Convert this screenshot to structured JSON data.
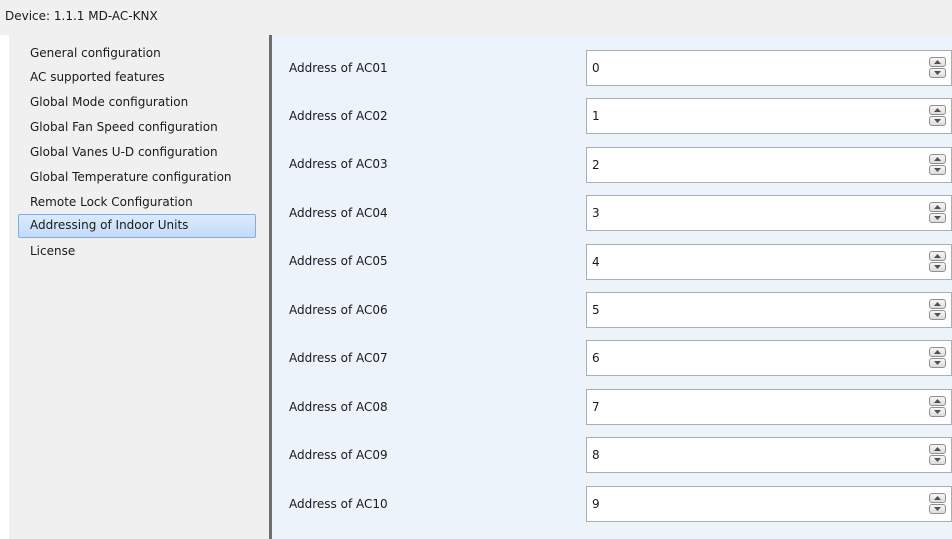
{
  "window": {
    "title": "Device: 1.1.1  MD-AC-KNX"
  },
  "sidebar": {
    "items": [
      {
        "label": "General configuration"
      },
      {
        "label": "AC supported features"
      },
      {
        "label": "Global Mode configuration"
      },
      {
        "label": "Global Fan Speed configuration"
      },
      {
        "label": "Global Vanes U-D configuration"
      },
      {
        "label": "Global Temperature configuration"
      },
      {
        "label": "Remote Lock Configuration"
      },
      {
        "label": "Addressing of Indoor Units",
        "selected": true
      },
      {
        "label": "License"
      }
    ]
  },
  "main": {
    "rows": [
      {
        "label": "Address of AC01",
        "value": "0"
      },
      {
        "label": "Address of AC02",
        "value": "1"
      },
      {
        "label": "Address of AC03",
        "value": "2"
      },
      {
        "label": "Address of AC04",
        "value": "3"
      },
      {
        "label": "Address of AC05",
        "value": "4"
      },
      {
        "label": "Address of AC06",
        "value": "5"
      },
      {
        "label": "Address of AC07",
        "value": "6"
      },
      {
        "label": "Address of AC08",
        "value": "7"
      },
      {
        "label": "Address of AC09",
        "value": "8"
      },
      {
        "label": "Address of AC10",
        "value": "9"
      }
    ]
  },
  "icons": {
    "spin_up": "triangle-up-icon",
    "spin_down": "triangle-down-icon"
  },
  "colors": {
    "selection_fill": "#c1dbfc",
    "selection_border": "#84acdd",
    "panel_background": "#ecf3fa",
    "sidebar_background": "#f0f0f0"
  }
}
